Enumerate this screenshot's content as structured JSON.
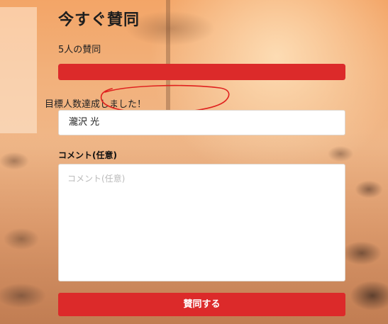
{
  "form": {
    "title": "今すぐ賛同",
    "supporter_count": "5人の賛同",
    "progress": 1.0,
    "goal_message": "目標人数達成しました！",
    "name_value": "瀧沢 光",
    "comment_label": "コメント(任意)",
    "comment_placeholder": "コメント(任意)",
    "submit_label": "賛同する"
  },
  "colors": {
    "accent": "#dc2a2a",
    "annotation": "#e0201e"
  }
}
